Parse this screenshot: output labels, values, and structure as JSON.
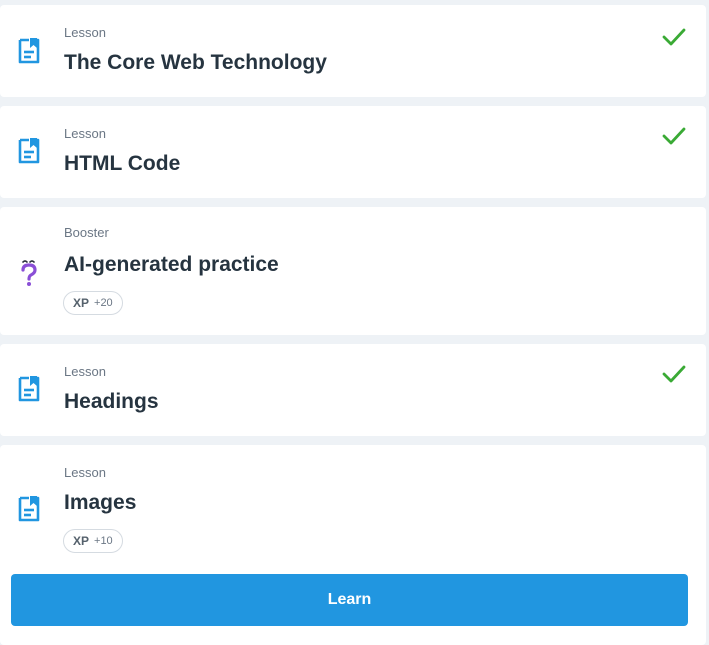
{
  "items": [
    {
      "kind": "Lesson",
      "title": "The Core Web Technology",
      "completed": true,
      "icon": "lesson-doc-icon"
    },
    {
      "kind": "Lesson",
      "title": "HTML Code",
      "completed": true,
      "icon": "lesson-doc-icon"
    },
    {
      "kind": "Booster",
      "title": "AI-generated practice",
      "completed": false,
      "icon": "question-mark-icon",
      "xp_label": "XP",
      "xp_value": "+20"
    },
    {
      "kind": "Lesson",
      "title": "Headings",
      "completed": true,
      "icon": "lesson-doc-icon"
    },
    {
      "kind": "Lesson",
      "title": "Images",
      "completed": false,
      "icon": "lesson-doc-icon",
      "xp_label": "XP",
      "xp_value": "+10"
    }
  ],
  "learn_button": {
    "label": "Learn"
  },
  "colors": {
    "accent": "#2196e0",
    "check": "#3aaa35",
    "booster": "#8a4fd6",
    "title": "#263440",
    "muted": "#6b7785"
  }
}
